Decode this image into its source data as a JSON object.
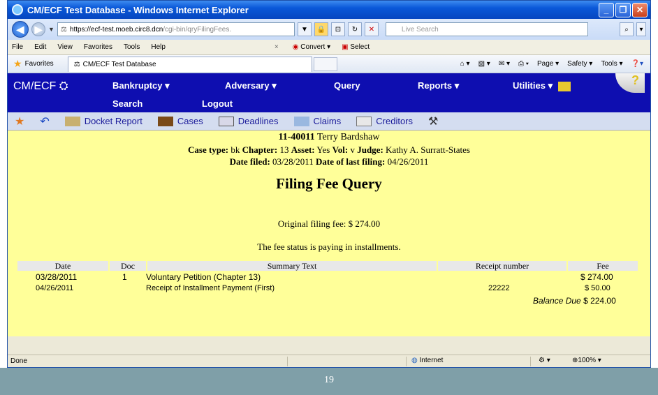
{
  "window": {
    "title": "CM/ECF Test Database - Windows Internet Explorer"
  },
  "address": {
    "url_host": "https://ecf-test.moeb.circ8.dcn",
    "url_path": "/cgi-bin/qryFilingFees.",
    "search_placeholder": "Live Search"
  },
  "menu": {
    "items": [
      "File",
      "Edit",
      "View",
      "Favorites",
      "Tools",
      "Help"
    ],
    "convert": "Convert",
    "select": "Select"
  },
  "favorites": {
    "label": "Favorites",
    "tab_title": "CM/ECF Test Database",
    "cmd_page": "Page",
    "cmd_safety": "Safety",
    "cmd_tools": "Tools"
  },
  "cmecf": {
    "logo": "CM/ECF",
    "nav": {
      "bankruptcy": "Bankruptcy",
      "adversary": "Adversary",
      "query": "Query",
      "reports": "Reports",
      "utilities": "Utilities",
      "search": "Search",
      "logout": "Logout"
    },
    "toolbar": {
      "docket_report": "Docket Report",
      "cases": "Cases",
      "deadlines": "Deadlines",
      "claims": "Claims",
      "creditors": "Creditors"
    }
  },
  "case": {
    "number": "11-40011",
    "debtor": "Terry Bardshaw",
    "case_type_label": "Case type:",
    "case_type": "bk",
    "chapter_label": "Chapter:",
    "chapter": "13",
    "asset_label": "Asset:",
    "asset": "Yes",
    "vol_label": "Vol:",
    "vol": "v",
    "judge_label": "Judge:",
    "judge": "Kathy A. Surratt-States",
    "date_filed_label": "Date filed:",
    "date_filed": "03/28/2011",
    "last_filing_label": "Date of last filing:",
    "last_filing": "04/26/2011"
  },
  "report": {
    "title": "Filing Fee Query",
    "original_fee": "Original filing fee: $ 274.00",
    "status": "The fee status is paying in installments."
  },
  "table": {
    "headers": [
      "Date",
      "Doc",
      "Summary Text",
      "Receipt number",
      "Fee"
    ],
    "rows": [
      {
        "date": "03/28/2011",
        "doc": "1",
        "summary": "Voluntary Petition (Chapter 13)",
        "receipt": "",
        "fee": "$ 274.00"
      },
      {
        "date": "04/26/2011",
        "doc": "",
        "summary": "Receipt of Installment Payment (First)",
        "receipt": "22222",
        "fee": "$ 50.00"
      }
    ],
    "balance_label": "Balance Due",
    "balance": "$ 224.00"
  },
  "status": {
    "text": "Done",
    "zone": "Internet",
    "zoom": "100%"
  },
  "slide": {
    "page_number": "19"
  }
}
